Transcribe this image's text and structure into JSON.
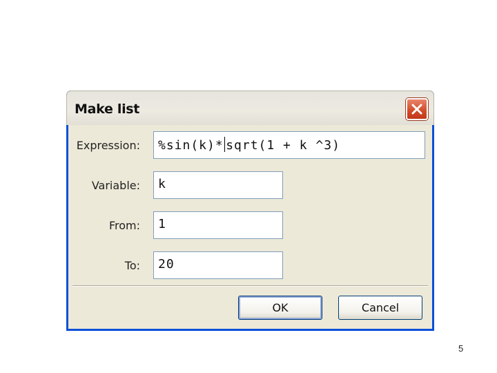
{
  "dialog": {
    "title": "Make list",
    "fields": {
      "expression": {
        "label": "Expression:",
        "before_caret": "%sin(k)*",
        "after_caret": "sqrt(1 + k ^3)"
      },
      "variable": {
        "label": "Variable:",
        "value": "k"
      },
      "from": {
        "label": "From:",
        "value": "1"
      },
      "to": {
        "label": "To:",
        "value": "20"
      }
    },
    "buttons": {
      "ok": "OK",
      "cancel": "Cancel"
    },
    "icons": {
      "close": "close-icon"
    },
    "colors": {
      "frame": "#0a4fd8",
      "body": "#ece9d8",
      "close": "#d24a26"
    }
  },
  "page": {
    "number": "5"
  }
}
